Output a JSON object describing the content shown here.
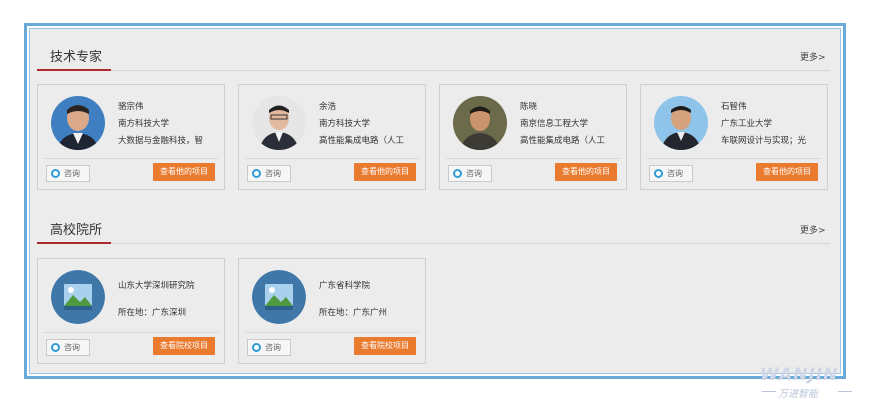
{
  "sections": {
    "experts": {
      "title": "技术专家",
      "more": "更多>"
    },
    "institutes": {
      "title": "高校院所",
      "more": "更多>"
    }
  },
  "experts": [
    {
      "name": "骆宗伟",
      "org": "南方科技大学",
      "field": "大数据与金融科技，智",
      "consult": "咨询",
      "action": "查看他的项目"
    },
    {
      "name": "余浩",
      "org": "南方科技大学",
      "field": "高性能集成电路（人工",
      "consult": "咨询",
      "action": "查看他的项目"
    },
    {
      "name": "陈晓",
      "org": "南京信息工程大学",
      "field": "高性能集成电路（人工",
      "consult": "咨询",
      "action": "查看他的项目"
    },
    {
      "name": "石智伟",
      "org": "广东工业大学",
      "field": "车联网设计与实现；光",
      "consult": "咨询",
      "action": "查看他的项目"
    }
  ],
  "institutes": [
    {
      "name": "山东大学深圳研究院",
      "location": "所在地：广东深圳",
      "consult": "咨询",
      "action": "查看院校项目"
    },
    {
      "name": "广东省科学院",
      "location": "所在地：广东广州",
      "consult": "咨询",
      "action": "查看院校项目"
    }
  ],
  "watermark": {
    "brand": "WANJIN",
    "tagline": "万进智能"
  },
  "colors": {
    "accent": "#ea7a2e",
    "frame": "#6aaad8",
    "title_underline": "#b0292d"
  }
}
